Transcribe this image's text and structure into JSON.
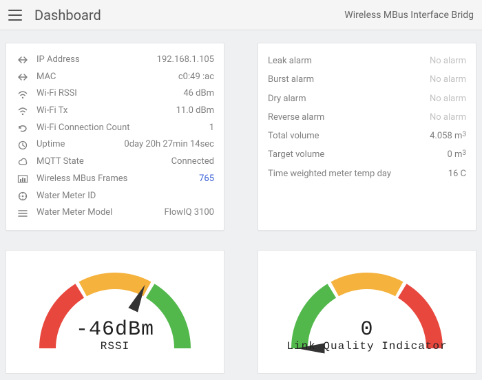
{
  "header": {
    "title": "Dashboard",
    "device_name": "Wireless MBus Interface Bridg"
  },
  "system_info": [
    {
      "icon": "net-icon",
      "label": "IP Address",
      "value": "192.168.1.105"
    },
    {
      "icon": "net-icon",
      "label": "MAC",
      "value": "c0:49            :ac"
    },
    {
      "icon": "wifi-icon",
      "label": "Wi-Fi RSSI",
      "value": "46 dBm"
    },
    {
      "icon": "wifi-icon",
      "label": "Wi-Fi Tx",
      "value": "11.0 dBm"
    },
    {
      "icon": "loop-icon",
      "label": "Wi-Fi Connection Count",
      "value": "1"
    },
    {
      "icon": "clock-icon",
      "label": "Uptime",
      "value": "0day 20h 27min 14sec"
    },
    {
      "icon": "cloud-icon",
      "label": "MQTT State",
      "value": "Connected"
    },
    {
      "icon": "chart-icon",
      "label": "Wireless MBus Frames",
      "value": "765",
      "link": true
    },
    {
      "icon": "tag-icon",
      "label": "Water Meter ID",
      "value": ""
    },
    {
      "icon": "list-icon",
      "label": "Water Meter Model",
      "value": "FlowIQ 3100"
    }
  ],
  "meter_data": [
    {
      "label": "Leak alarm",
      "value": "No alarm",
      "muted": true
    },
    {
      "label": "Burst alarm",
      "value": "No alarm",
      "muted": true
    },
    {
      "label": "Dry alarm",
      "value": "No alarm",
      "muted": true
    },
    {
      "label": "Reverse alarm",
      "value": "No alarm",
      "muted": true
    },
    {
      "label": "Total volume",
      "value": "4.058 m³"
    },
    {
      "label": "Target volume",
      "value": "0 m³"
    },
    {
      "label": "Time weighted meter temp day",
      "value": "16 C"
    }
  ],
  "gauges": {
    "rssi": {
      "value_text": "-46dBm",
      "label": "RSSI",
      "fraction": 0.64
    },
    "lqi": {
      "value_text": "0",
      "label": "Link Quality Indicator",
      "fraction": 0.0
    }
  },
  "chart_data": [
    {
      "type": "gauge",
      "title": "RSSI",
      "value_display": "-46dBm",
      "value_numeric": -46,
      "unit": "dBm",
      "needle_fraction": 0.64,
      "segments": [
        "red",
        "orange",
        "green"
      ]
    },
    {
      "type": "gauge",
      "title": "Link Quality Indicator",
      "value_display": "0",
      "value_numeric": 0,
      "needle_fraction": 0.0,
      "segments": [
        "green",
        "orange",
        "red"
      ]
    }
  ],
  "colors": {
    "red": "#e8473e",
    "orange": "#f5b23d",
    "green": "#52b84b"
  }
}
